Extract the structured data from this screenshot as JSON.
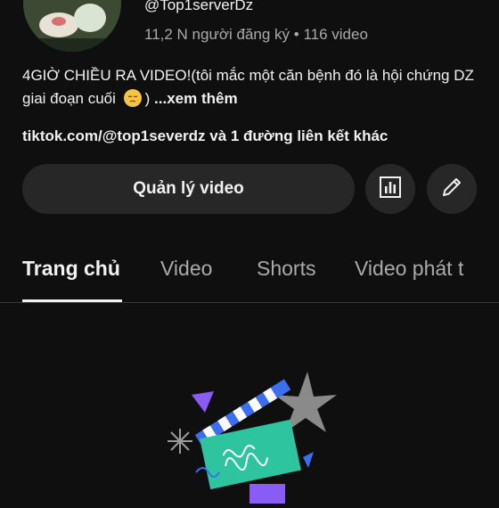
{
  "channel": {
    "handle": "@Top1serverDz",
    "subscribers": "11,2 N người đăng ký",
    "separator": "•",
    "video_count": "116 video",
    "description": "4GIỜ CHIỀU RA VIDEO!(tôi mắc một căn bệnh đó là hội chứng DZ giai đoạn cuối ",
    "description_tail": ")",
    "more_label": " ...xem thêm",
    "link_text": "tiktok.com/@top1severdz và 1 đường liên kết khác"
  },
  "actions": {
    "manage_label": "Quản lý video",
    "analytics_icon": "analytics-icon",
    "edit_icon": "pencil-icon"
  },
  "tabs": [
    {
      "label": "Trang chủ",
      "active": true
    },
    {
      "label": "Video",
      "active": false
    },
    {
      "label": "Shorts",
      "active": false
    },
    {
      "label": "Video phát t",
      "active": false
    }
  ],
  "colors": {
    "background": "#0f0f0f",
    "button": "#272727",
    "text": "#f1f1f1",
    "muted": "#aaaaaa",
    "illustration_teal": "#2ec4a0",
    "illustration_purple": "#8a5cf6",
    "illustration_blue": "#3b6ff0"
  }
}
